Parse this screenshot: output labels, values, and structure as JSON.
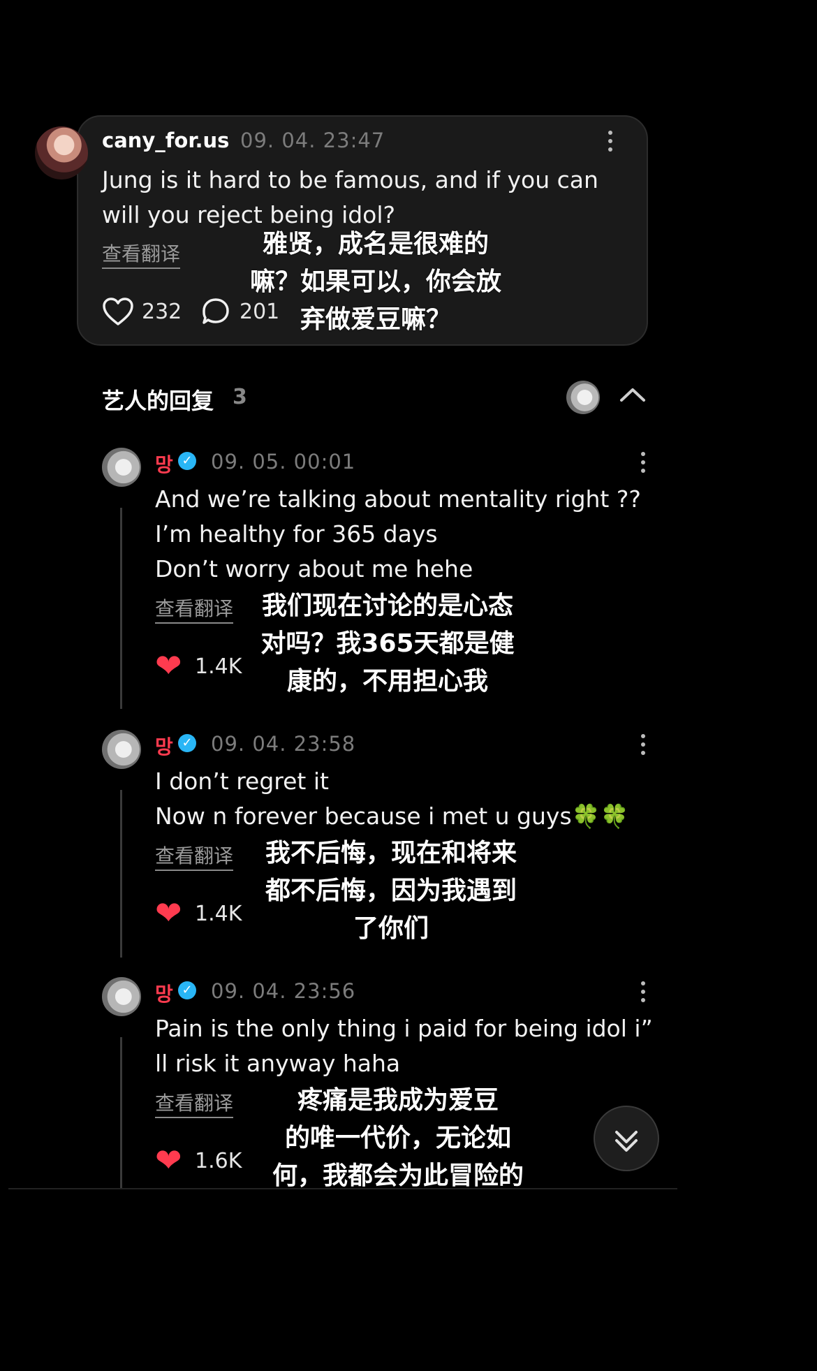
{
  "parent_comment": {
    "username": "cany_for.us",
    "timestamp": "09. 04. 23:47",
    "text_line1": "Jung is it hard to be famous, and if you can",
    "text_line2": "will you reject being idol?",
    "translate_label": "查看翻译",
    "likes": "232",
    "replies": "201",
    "overlay_cn_line1": "雅贤，成名是很难的",
    "overlay_cn_line2": "嘛？如果可以，你会放",
    "overlay_cn_line3": "弃做爱豆嘛？"
  },
  "artist_replies": {
    "title": "艺人的回复",
    "count": "3"
  },
  "replies": [
    {
      "username": "망",
      "timestamp": "09. 05. 00:01",
      "line1": "And we’re talking about mentality right ??",
      "line2": "I’m healthy for 365 days",
      "line3": "Don’t worry about me hehe",
      "translate_label": "查看翻译",
      "likes": "1.4K",
      "cn1": "我们现在讨论的是心态",
      "cn2": "对吗？我365天都是健",
      "cn3": "康的，不用担心我"
    },
    {
      "username": "망",
      "timestamp": "09. 04. 23:58",
      "line1": "I don’t regret it",
      "line2": "Now n forever because i met u guys🍀🍀",
      "translate_label": "查看翻译",
      "likes": "1.4K",
      "cn1": "我不后悔，现在和将来",
      "cn2": "都不后悔，因为我遇到",
      "cn3": "了你们"
    },
    {
      "username": "망",
      "timestamp": "09. 04. 23:56",
      "line1": "Pain is the only thing i paid for being idol i”",
      "line2": "ll risk it anyway haha",
      "translate_label": "查看翻译",
      "likes": "1.6K",
      "cn1": "疼痛是我成为爱豆",
      "cn2": "的唯一代价，无论如",
      "cn3": "何，我都会为此冒险的"
    }
  ],
  "colors": {
    "background": "#000000",
    "card": "#1a1a1a",
    "accent_red": "#ff3b4f",
    "verified_blue": "#29b6f6"
  }
}
